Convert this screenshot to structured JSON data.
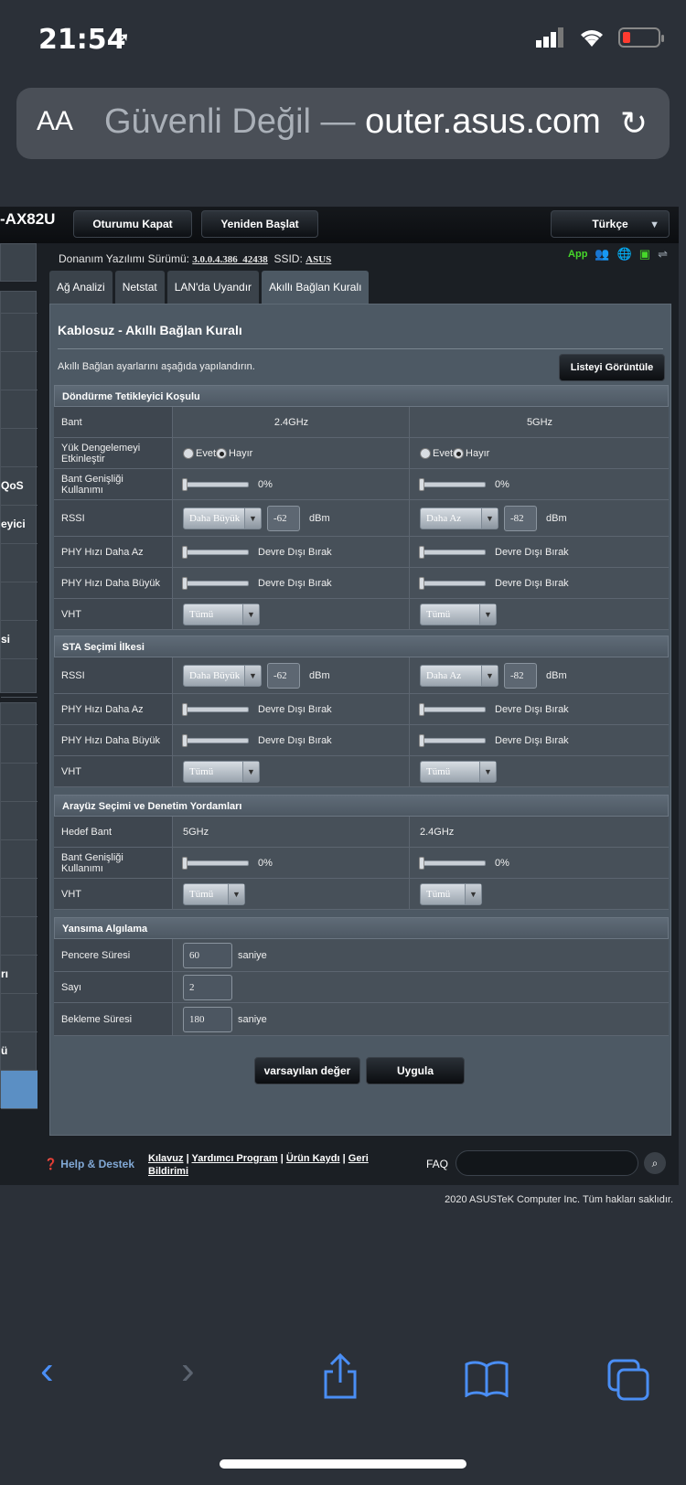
{
  "status": {
    "time": "21:54",
    "location_icon": "location-arrow-icon"
  },
  "browser": {
    "aa_label": "AA",
    "url_secure_label": "Güvenli Değil — ",
    "url_host": "outer.asus.com"
  },
  "router": {
    "model": "-AX82U",
    "logout_label": "Oturumu Kapat",
    "reboot_label": "Yeniden Başlat",
    "language": "Türkçe",
    "firmware_label": "Donanım Yazılımı Sürümü:",
    "firmware_version": "3.0.0.4.386_42438",
    "ssid_label": "SSID:",
    "ssid_value": "ASUS",
    "app_label": "App",
    "sidebar_labels": [
      "QoS",
      "eyici",
      "si",
      "rı",
      "ü"
    ],
    "tabs": [
      "Ağ Analizi",
      "Netstat",
      "LAN'da Uyandır",
      "Akıllı Bağlan Kuralı"
    ],
    "title": "Kablosuz - Akıllı Bağlan Kuralı",
    "description": "Akıllı Bağlan ayarlarını aşağıda yapılandırın.",
    "list_button": "Listeyi Görüntüle",
    "sections": {
      "trigger": "Döndürme Tetikleyici Koşulu",
      "sta": "STA Seçimi İlkesi",
      "interface": "Arayüz Seçimi ve Denetim Yordamları",
      "bounce": "Yansıma Algılama"
    },
    "labels": {
      "band": "Bant",
      "load_balance": "Yük Dengelemeyi Etkinleştir",
      "bw_usage": "Bant Genişliği Kullanımı",
      "rssi": "RSSI",
      "phy_less": "PHY Hızı Daha Az",
      "phy_greater": "PHY Hızı Daha Büyük",
      "vht": "VHT",
      "target_band": "Hedef Bant",
      "window_time": "Pencere Süresi",
      "count": "Sayı",
      "dwell_time": "Bekleme Süresi"
    },
    "values": {
      "band_24": "2.4GHz",
      "band_5": "5GHz",
      "yes": "Evet",
      "no": "Hayır",
      "pct0": "0%",
      "greater": "Daha Büyük",
      "less": "Daha Az",
      "rssi_24": "-62",
      "rssi_5": "-82",
      "dbm": "dBm",
      "disable": "Devre Dışı Bırak",
      "all": "Tümü",
      "window": "60",
      "count": "2",
      "dwell": "180",
      "seconds": "saniye"
    },
    "default_button": "varsayılan değer",
    "apply_button": "Uygula",
    "help_label": "Help & Destek",
    "footer_links": [
      "Kılavuz",
      "Yardımcı Program",
      "Ürün Kaydı",
      "Geri Bildirimi"
    ],
    "faq_label": "FAQ",
    "copyright": "2020 ASUSTeK Computer Inc. Tüm hakları saklıdır."
  }
}
